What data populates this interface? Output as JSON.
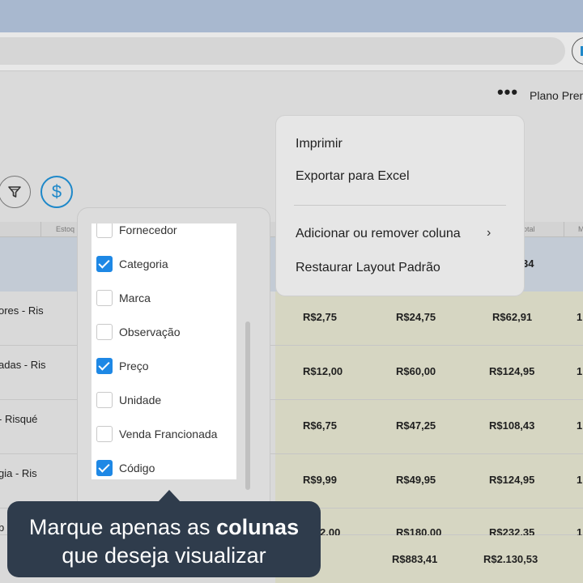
{
  "toolbar": {
    "more_label": "•••",
    "plan_label": "Plano Pren"
  },
  "grid": {
    "headers": {
      "estoque": "Estoq",
      "total": "otal",
      "m": "M"
    },
    "highlight_value": "34",
    "rows": [
      {
        "name": "ores - Ris",
        "v1": "R$2,75",
        "v2": "R$24,75",
        "v3": "R$62,91",
        "edge": "1"
      },
      {
        "name": "adas - Ris",
        "v1": "R$12,00",
        "v2": "R$60,00",
        "v3": "R$124,95",
        "edge": "1"
      },
      {
        "name": "- Risqué",
        "v1": "R$6,75",
        "v2": "R$47,25",
        "v3": "R$108,43",
        "edge": "1"
      },
      {
        "name": "gia - Ris",
        "v1": "R$9,99",
        "v2": "R$49,95",
        "v3": "R$124,95",
        "edge": "1"
      },
      {
        "name": "b",
        "v1": "2,00",
        "v2": "R$180,00",
        "v3": "R$232,35",
        "edge": "1"
      }
    ],
    "totals": {
      "v2": "R$883,41",
      "v3": "R$2.130,53"
    }
  },
  "columns_panel": {
    "items": [
      {
        "label": "Fornecedor",
        "checked": false
      },
      {
        "label": "Categoria",
        "checked": true
      },
      {
        "label": "Marca",
        "checked": false
      },
      {
        "label": "Observação",
        "checked": false
      },
      {
        "label": "Preço",
        "checked": true
      },
      {
        "label": "Unidade",
        "checked": false
      },
      {
        "label": "Venda Francionada",
        "checked": false
      },
      {
        "label": "Código",
        "checked": true
      }
    ]
  },
  "menu": {
    "print": "Imprimir",
    "export": "Exportar para Excel",
    "add_remove": "Adicionar ou remover coluna",
    "chevron": "›",
    "restore": "Restaurar Layout Padrão"
  },
  "tooltip": {
    "line1_prefix": "Marque apenas as ",
    "line1_bold": "colunas",
    "line2": "que deseja visualizar"
  },
  "colors": {
    "accent": "#1e88e5",
    "tooltip_bg": "#2f3c4c"
  }
}
